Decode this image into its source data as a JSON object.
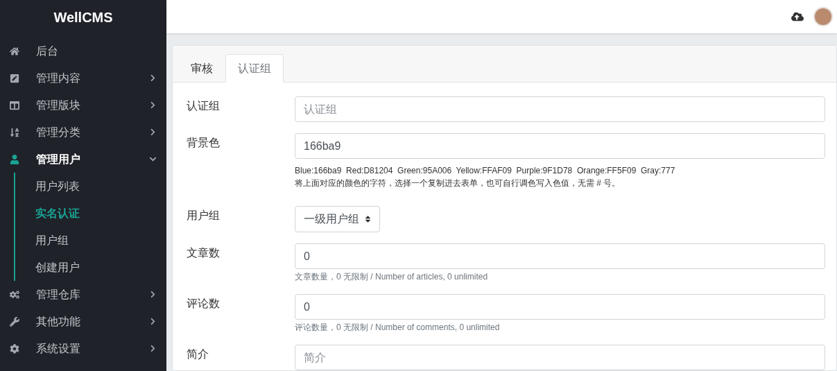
{
  "brand": "WellCMS",
  "sidebar": {
    "items": [
      {
        "label": "后台",
        "kind": "link",
        "selected": false
      },
      {
        "label": "管理内容",
        "kind": "menu",
        "selected": false,
        "expanded": false
      },
      {
        "label": "管理版块",
        "kind": "menu",
        "selected": false,
        "expanded": false
      },
      {
        "label": "管理分类",
        "kind": "menu",
        "selected": false,
        "expanded": false
      },
      {
        "label": "管理用户",
        "kind": "menu",
        "selected": true,
        "expanded": true,
        "children": [
          {
            "label": "用户列表",
            "selected": false
          },
          {
            "label": "实名认证",
            "selected": true
          },
          {
            "label": "用户组",
            "selected": false
          },
          {
            "label": "创建用户",
            "selected": false
          }
        ]
      },
      {
        "label": "管理仓库",
        "kind": "menu",
        "selected": false,
        "expanded": false
      },
      {
        "label": "其他功能",
        "kind": "menu",
        "selected": false,
        "expanded": false
      },
      {
        "label": "系统设置",
        "kind": "menu",
        "selected": false,
        "expanded": false
      }
    ]
  },
  "tabs": [
    {
      "label": "审核",
      "selected": false
    },
    {
      "label": "认证组",
      "selected": true
    }
  ],
  "form": {
    "rows": [
      {
        "label": "认证组",
        "field": {
          "kind": "input",
          "placeholder": "认证组"
        }
      },
      {
        "label": "背景色",
        "field": {
          "kind": "input",
          "value": "166ba9"
        },
        "help": [
          "Blue:166ba9  Red:D81204  Green:95A006  Yellow:FFAF09  Purple:9F1D78  Orange:FF5F09  Gray:777",
          "将上面对应的颜色的字符，选择一个复制进去表单，也可自行调色写入色值，无需 # 号。"
        ]
      },
      {
        "label": "用户组",
        "field": {
          "kind": "select",
          "value": "一级用户组"
        }
      },
      {
        "label": "文章数",
        "field": {
          "kind": "input",
          "value": "0"
        },
        "help": [
          "文章数量，0 无限制 / Number of articles, 0 unlimited"
        ]
      },
      {
        "label": "评论数",
        "field": {
          "kind": "input",
          "value": "0"
        },
        "help": [
          "评论数量，0 无限制 / Number of comments, 0 unlimited"
        ]
      },
      {
        "label": "简介",
        "field": {
          "kind": "input",
          "placeholder": "简介"
        }
      }
    ]
  }
}
